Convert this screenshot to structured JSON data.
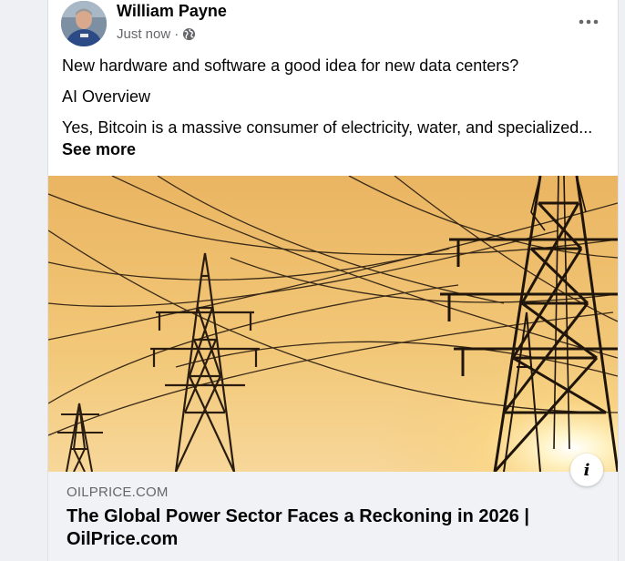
{
  "post": {
    "author": "William Payne",
    "timestamp": "Just now",
    "separator": "·",
    "privacy_icon": "globe-icon",
    "more_icon": "more-options-icon",
    "paragraphs": [
      "New hardware and software a good idea for new data centers?",
      "AI Overview",
      "Yes, Bitcoin is a massive consumer of electricity, water, and specialized..."
    ],
    "see_more": "See more"
  },
  "link_preview": {
    "image_subject": "high-voltage transmission towers at sunset",
    "domain": "OILPRICE.COM",
    "title": "The Global Power Sector Faces a Reckoning in 2026 | OilPrice.com",
    "info_icon": "info-icon"
  },
  "colors": {
    "page_bg": "#eef0f3",
    "card_bg": "#ffffff",
    "footer_bg": "#f0f2f5",
    "secondary_text": "#65676b",
    "primary_text": "#050505",
    "sky": "#e5a84c"
  }
}
